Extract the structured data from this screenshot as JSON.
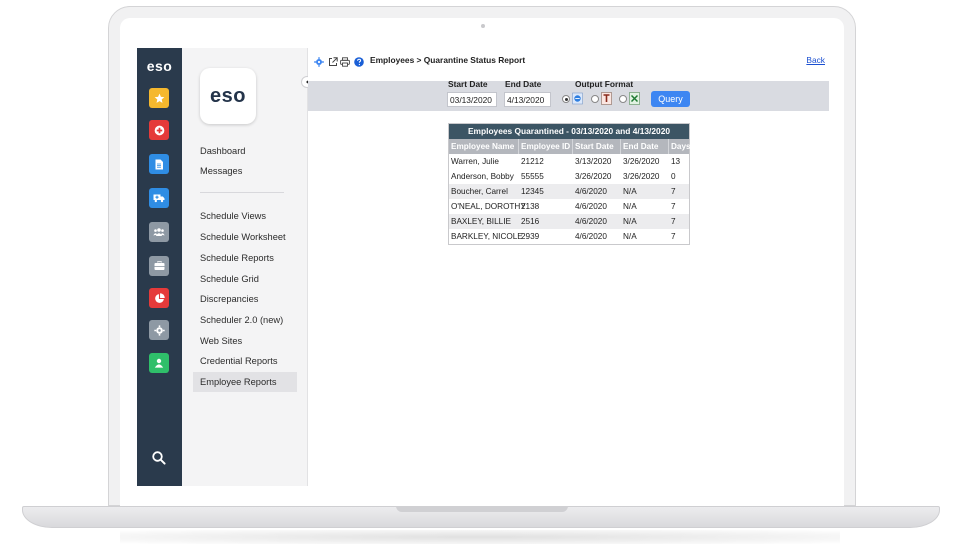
{
  "rail": {
    "logo": "eso",
    "buttons": [
      {
        "icon": "star-icon",
        "color": "#f5b82e"
      },
      {
        "icon": "medical-plus-icon",
        "color": "#e53a3a"
      },
      {
        "icon": "document-icon",
        "color": "#2f8de4"
      },
      {
        "icon": "ambulance-icon",
        "color": "#2f8de4"
      },
      {
        "icon": "group-icon",
        "color": "#8e99a4"
      },
      {
        "icon": "briefcase-icon",
        "color": "#8e99a4"
      },
      {
        "icon": "pie-chart-icon",
        "color": "#e53a3a"
      },
      {
        "icon": "gear-icon",
        "color": "#8e99a4"
      },
      {
        "icon": "user-icon",
        "color": "#2fbf6a"
      }
    ],
    "search_icon": "search-icon"
  },
  "sidebar": {
    "brand": "eso",
    "items": [
      {
        "label": "Dashboard"
      },
      {
        "label": "Messages"
      },
      {
        "label": "Schedule Views"
      },
      {
        "label": "Schedule Worksheet"
      },
      {
        "label": "Schedule Reports"
      },
      {
        "label": "Schedule Grid"
      },
      {
        "label": "Discrepancies"
      },
      {
        "label": "Scheduler 2.0 (new)"
      },
      {
        "label": "Web Sites"
      },
      {
        "label": "Credential Reports"
      },
      {
        "label": "Employee Reports"
      }
    ],
    "active": "Employee Reports"
  },
  "toolbar": {
    "breadcrumb": "Employees > Quarantine Status Report",
    "back": "Back"
  },
  "filters": {
    "start_label": "Start Date",
    "start_value": "03/13/2020",
    "end_label": "End Date",
    "end_value": "4/13/2020",
    "format_label": "Output Format",
    "formats": [
      "ie",
      "pdf",
      "excel"
    ],
    "selected_format": "ie",
    "query": "Query"
  },
  "report": {
    "title": "Employees Quarantined - 03/13/2020 and 4/13/2020",
    "columns": [
      "Employee Name",
      "Employee ID",
      "Start Date",
      "End Date",
      "Days"
    ],
    "rows": [
      [
        "Warren, Julie",
        "21212",
        "3/13/2020",
        "3/26/2020",
        "13"
      ],
      [
        "Anderson, Bobby",
        "55555",
        "3/26/2020",
        "3/26/2020",
        "0"
      ],
      [
        "Boucher, Carrel",
        "12345",
        "4/6/2020",
        "N/A",
        "7"
      ],
      [
        "O'NEAL, DOROTHY",
        "2138",
        "4/6/2020",
        "N/A",
        "7"
      ],
      [
        "BAXLEY, BILLIE",
        "2516",
        "4/6/2020",
        "N/A",
        "7"
      ],
      [
        "BARKLEY, NICOLE",
        "2939",
        "4/6/2020",
        "N/A",
        "7"
      ]
    ]
  }
}
